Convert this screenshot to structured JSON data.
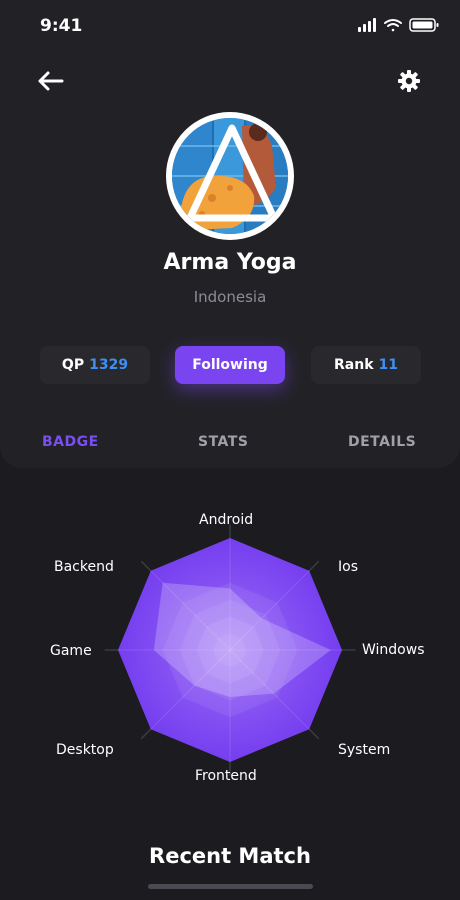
{
  "status": {
    "time": "9:41"
  },
  "profile": {
    "name": "Arma Yoga",
    "country": "Indonesia"
  },
  "stats": {
    "qp_label": "QP",
    "qp_value": "1329",
    "follow_label": "Following",
    "rank_label": "Rank",
    "rank_value": "11"
  },
  "tabs": [
    "BADGE",
    "STATS",
    "DETAILS"
  ],
  "active_tab": "BADGE",
  "chart_data": {
    "type": "radar",
    "axes": [
      "Android",
      "Ios",
      "Windows",
      "System",
      "Frontend",
      "Desktop",
      "Game",
      "Backend"
    ],
    "series": [
      {
        "values": [
          1.0,
          1.0,
          1.0,
          1.0,
          1.0,
          1.0,
          1.0,
          1.0
        ]
      },
      {
        "values": [
          0.55,
          0.4,
          0.9,
          0.55,
          0.42,
          0.45,
          0.68,
          0.85
        ]
      }
    ],
    "rings": 4
  },
  "section": {
    "recent_match": "Recent Match"
  },
  "colors": {
    "accent": "#7a45f0",
    "number_blue": "#3f8ff2",
    "background": "#1c1c20",
    "panel": "#222226"
  },
  "icons": {
    "back": "arrow-left-icon",
    "settings": "gear-icon"
  }
}
